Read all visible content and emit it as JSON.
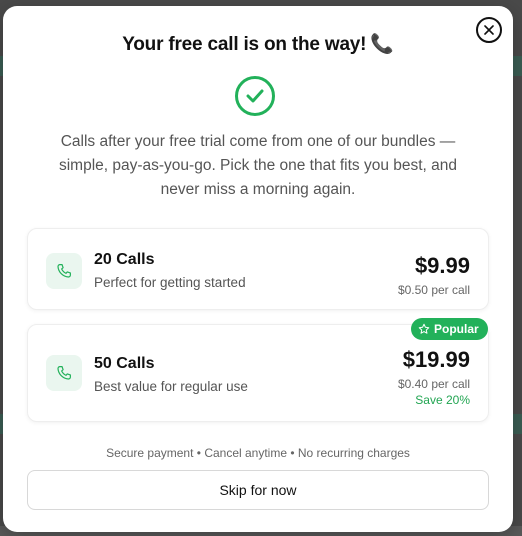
{
  "modal": {
    "title": "Your free call is on the way!",
    "title_emoji": "📞",
    "success_icon": "check-circle-icon",
    "subtitle": "Calls after your free trial come from one of our bundles — simple, pay-as-you-go. Pick the one that fits you best, and never miss a morning again.",
    "close_icon": "close-icon"
  },
  "bundles": [
    {
      "name": "20 Calls",
      "description": "Perfect for getting started",
      "price": "$9.99",
      "per_call": "$0.50 per call",
      "icon": "phone-icon"
    },
    {
      "name": "50 Calls",
      "description": "Best value for regular use",
      "price": "$19.99",
      "per_call": "$0.40 per call",
      "savings": "Save 20%",
      "badge": "Popular",
      "badge_icon": "star-icon",
      "icon": "phone-icon"
    }
  ],
  "footer": {
    "note": "Secure payment • Cancel anytime • No recurring charges",
    "skip_label": "Skip for now"
  },
  "colors": {
    "accent": "#22b15a",
    "accent_light": "#eaf6ef"
  }
}
